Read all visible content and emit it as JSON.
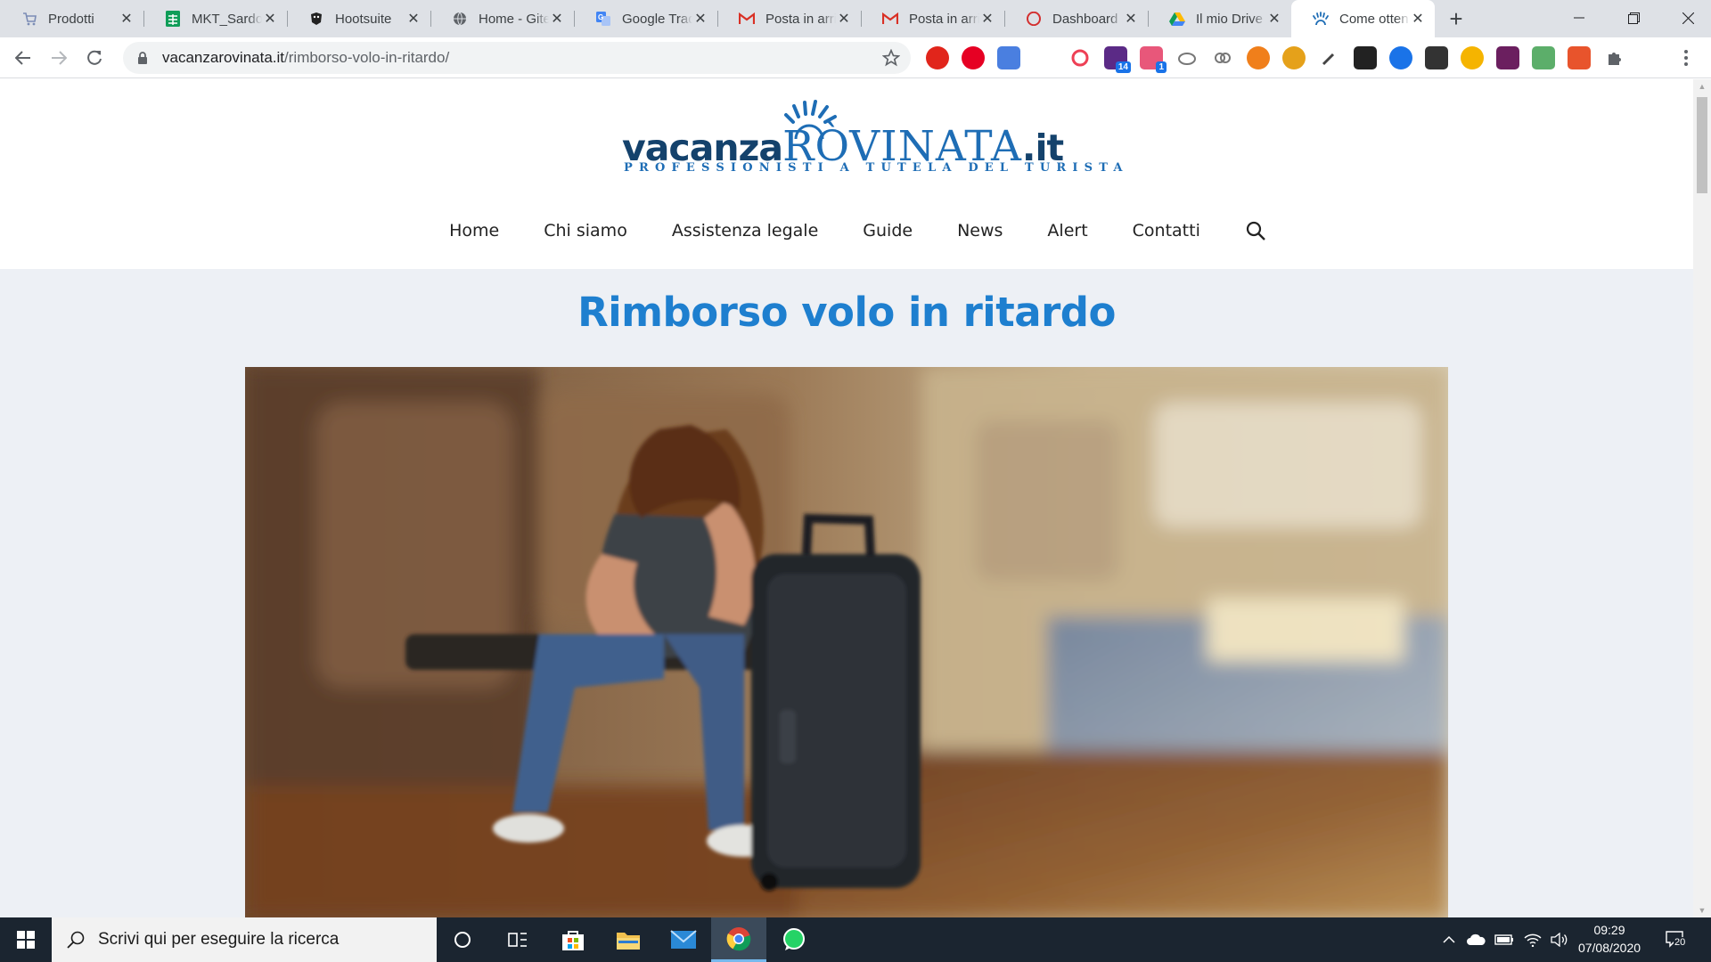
{
  "browser": {
    "tabs": [
      {
        "title": "Prodotti",
        "icon": "cart-icon",
        "active": false
      },
      {
        "title": "MKT_Sardo_",
        "icon": "sheets-icon",
        "active": false
      },
      {
        "title": "Hootsuite",
        "icon": "hootsuite-icon",
        "active": false
      },
      {
        "title": "Home - Gite",
        "icon": "globe-icon",
        "active": false
      },
      {
        "title": "Google Trad",
        "icon": "translate-icon",
        "active": false
      },
      {
        "title": "Posta in arri",
        "icon": "gmail-icon",
        "active": false
      },
      {
        "title": "Posta in arri",
        "icon": "gmail-icon",
        "active": false
      },
      {
        "title": "Dashboard |",
        "icon": "opera-icon",
        "active": false
      },
      {
        "title": "Il mio Drive",
        "icon": "drive-icon",
        "active": false
      },
      {
        "title": "Come otten",
        "icon": "vacanzarovinata-icon",
        "active": true
      }
    ],
    "new_tab": "+",
    "url_domain": "vacanzarovinata.it",
    "url_path": "/rimborso-volo-in-ritardo/",
    "extension_badges": {
      "ext5": "14",
      "ext6": "1"
    }
  },
  "site": {
    "logo_word": "vacanza",
    "logo_word_blue": "RÒVINATA",
    "logo_tld": ".it",
    "logo_tagline": "PROFESSIONISTI A TUTELA DEL TURISTA",
    "nav": [
      "Home",
      "Chi siamo",
      "Assistenza legale",
      "Guide",
      "News",
      "Alert",
      "Contatti"
    ],
    "page_title": "Rimborso volo in ritardo",
    "hero_image": "woman-with-suitcase-at-airport"
  },
  "taskbar": {
    "search_placeholder": "Scrivi qui per eseguire la ricerca",
    "time": "09:29",
    "date": "07/08/2020",
    "notification_count": "20"
  },
  "colors": {
    "accent": "#1e7fcf",
    "logo_dark": "#14426c",
    "page_bg": "#edf0f5",
    "taskbar": "#1b2530"
  }
}
